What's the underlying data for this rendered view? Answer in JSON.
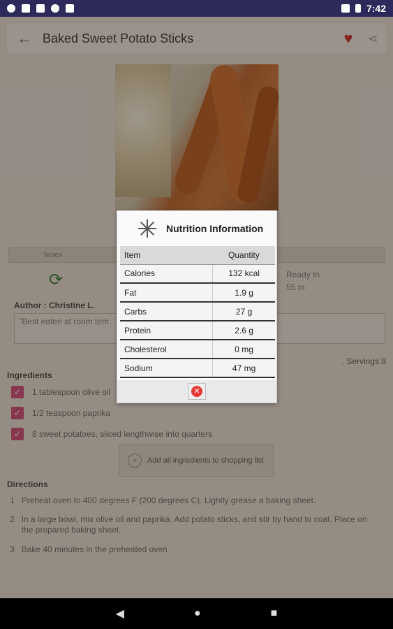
{
  "status": {
    "time": "7:42"
  },
  "header": {
    "title": "Baked Sweet Potato Sticks",
    "back_icon": "←",
    "favorite_icon": "♥",
    "share_icon": "⋖"
  },
  "tabs": {
    "label": "Notes"
  },
  "recipe": {
    "ready_label": "Ready In",
    "ready_value": "55 m",
    "author": "Author : Christine L.",
    "note": "\"Best eaten at room tem",
    "servings": ". Servings:8"
  },
  "ingredients": {
    "heading": "Ingredients",
    "items": [
      "1 tablespoon olive oil",
      "1/2 teaspoon paprika",
      "8 sweet potatoes, sliced lengthwise into quarters"
    ],
    "add_button": "Add all ingredients to shopping list"
  },
  "directions": {
    "heading": "Directions",
    "steps": [
      {
        "n": "1",
        "text": "Preheat oven to 400 degrees F (200 degrees C). Lightly grease a baking sheet."
      },
      {
        "n": "2",
        "text": "In a large bowl, mix olive oil and paprika. Add potato sticks, and stir by hand to coat. Place on the prepared baking sheet."
      },
      {
        "n": "3",
        "text": "Bake 40 minutes in the preheated oven"
      }
    ]
  },
  "nutrition": {
    "title": "Nutrition Information",
    "col_item": "Item",
    "col_qty": "Quantity",
    "rows": [
      {
        "item": "Calories",
        "qty": "132 kcal"
      },
      {
        "item": "Fat",
        "qty": "1.9 g"
      },
      {
        "item": "Carbs",
        "qty": "27 g"
      },
      {
        "item": "Protein",
        "qty": "2.6 g"
      },
      {
        "item": "Cholesterol",
        "qty": "0 mg"
      },
      {
        "item": "Sodium",
        "qty": "47 mg"
      }
    ]
  },
  "nav": {
    "back": "◀",
    "home": "●",
    "recents": "■"
  }
}
